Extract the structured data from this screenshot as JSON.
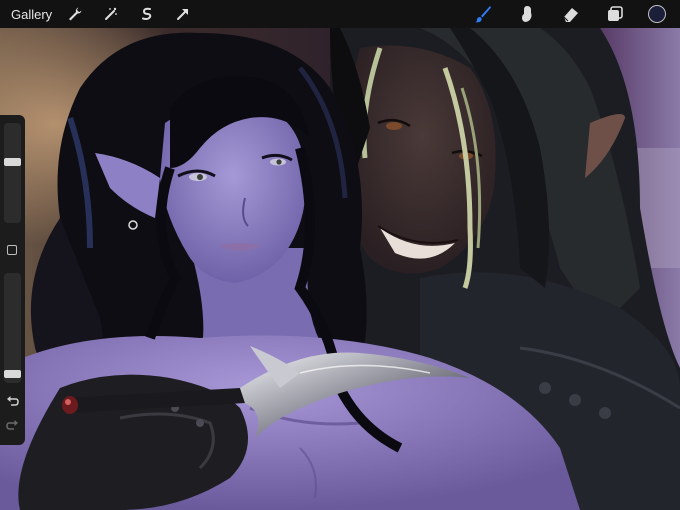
{
  "toolbar": {
    "gallery_label": "Gallery",
    "left_tools": [
      "wrench-icon",
      "magic-wand-icon",
      "selection-icon",
      "transform-arrow-icon"
    ],
    "right_tools": [
      "brush-icon",
      "smudge-icon",
      "eraser-icon",
      "layers-icon"
    ],
    "active_tool": "brush-icon",
    "accent_color": "#2f7cf6",
    "current_color": "#1c1f3a"
  },
  "sidebar": {
    "brush_size": 0.62,
    "brush_opacity": 0.05,
    "icons": [
      "modify-square-icon",
      "undo-icon",
      "redo-icon"
    ]
  },
  "canvas": {
    "content": "digital-painting-artwork"
  }
}
